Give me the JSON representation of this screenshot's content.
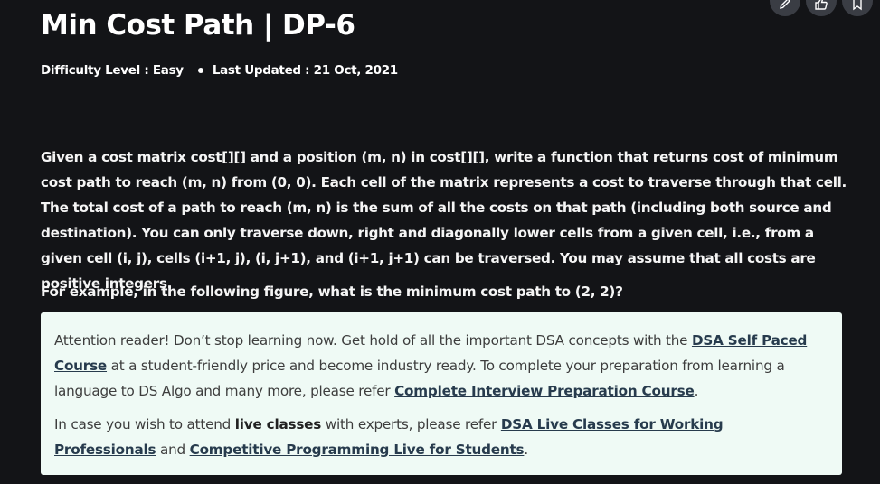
{
  "article": {
    "title": "Min Cost Path | DP-6",
    "difficulty": "Difficulty Level : Easy",
    "last_updated": "Last Updated : 21 Oct, 2021",
    "paragraph": "Given a cost matrix cost[][] and a position (m, n) in cost[][], write a function that returns cost of minimum cost path to reach (m, n) from (0, 0). Each cell of the matrix represents a cost to traverse through that cell. The total cost of a path to reach (m, n) is the sum of all the costs on that path (including both source and destination). You can only traverse down, right and diagonally lower cells from a given cell, i.e., from a given cell (i, j), cells (i+1, j), (i, j+1), and (i+1, j+1) can be traversed. You may assume that all costs are positive integers.",
    "example_question": "For example, in the following figure, what is the minimum cost path to (2, 2)?"
  },
  "actions": {
    "edit_icon": "pencil-icon",
    "like_icon": "thumbs-up-icon",
    "bookmark_icon": "bookmark-icon"
  },
  "notice": {
    "p1_text1": "Attention reader! Don’t stop learning now. Get hold of all the important DSA concepts with the ",
    "p1_link1": "DSA Self Paced Course",
    "p1_text2": " at a student-friendly price and become industry ready.  To complete your preparation from learning a language to DS Algo and many more,  please refer ",
    "p1_link2": "Complete Interview Preparation Course",
    "p1_text3": ".",
    "p2_text1": "In case you wish to attend ",
    "p2_bold": "live classes",
    "p2_text2": " with experts, please refer ",
    "p2_link1": "DSA Live Classes for Working Professionals",
    "p2_text3": " and ",
    "p2_link2": "Competitive Programming Live for Students",
    "p2_text4": "."
  },
  "colors": {
    "background": "#131417",
    "notice_bg": "#effaf5",
    "link": "#273b4d"
  }
}
